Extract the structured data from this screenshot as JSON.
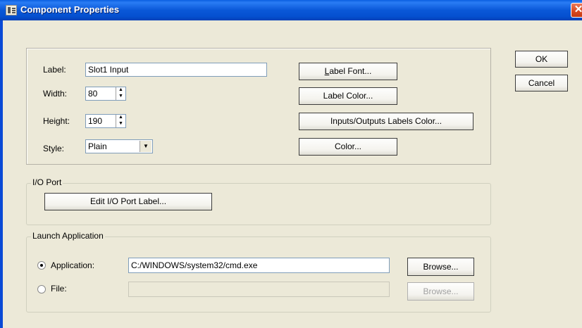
{
  "window": {
    "title": "Component Properties",
    "close_glyph": "✕"
  },
  "properties": {
    "label_caption": "Label:",
    "label_value": "Slot1 Input",
    "width_caption": "Width:",
    "width_value": "80",
    "height_caption": "Height:",
    "height_value": "190",
    "style_caption": "Style:",
    "style_value": "Plain"
  },
  "buttons": {
    "label_font": "Label Font...",
    "label_color": "Label Color...",
    "io_labels_color": "Inputs/Outputs Labels Color...",
    "color": "Color...",
    "ok": "OK",
    "cancel": "Cancel"
  },
  "io_port": {
    "group_label": "I/O Port",
    "edit_button": "Edit I/O Port Label..."
  },
  "launch": {
    "group_label": "Launch Application",
    "application_label": "Application:",
    "application_value": "C:/WINDOWS/system32/cmd.exe",
    "application_checked": true,
    "file_label": "File:",
    "file_value": "",
    "browse_label": "Browse...",
    "browse_disabled_label": "Browse..."
  },
  "icons": {
    "app": "component-properties-icon",
    "close": "close-icon"
  }
}
